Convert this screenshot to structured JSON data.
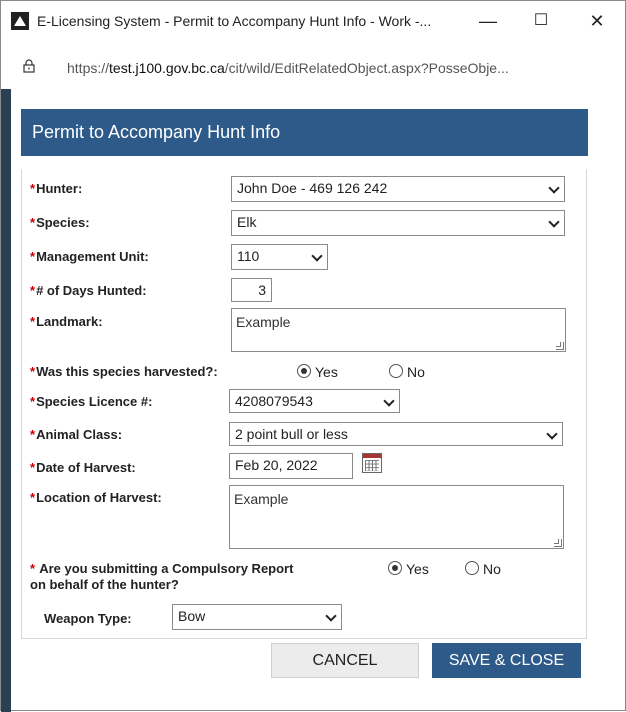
{
  "window": {
    "title": "E-Licensing System - Permit to Accompany Hunt Info - Work -...",
    "minimize_label": "—",
    "maximize_label": "☐",
    "close_label": "✕"
  },
  "address": {
    "url_prefix": "https://",
    "url_host": "test.j100.gov.bc.ca",
    "url_path": "/cit/wild/EditRelatedObject.aspx?PosseObje..."
  },
  "panel": {
    "title": "Permit to Accompany Hunt Info"
  },
  "form": {
    "required_mark": "*",
    "hunter": {
      "label": "Hunter:",
      "value": "John Doe - 469 126 242"
    },
    "species": {
      "label": "Species:",
      "value": "Elk"
    },
    "management_unit": {
      "label": "Management Unit:",
      "value": "110"
    },
    "days_hunted": {
      "label": "# of Days Hunted:",
      "value": "3"
    },
    "landmark": {
      "label": "Landmark:",
      "value": "Example"
    },
    "harvested": {
      "label": "Was this species harvested?:",
      "yes": "Yes",
      "no": "No",
      "selected": "Yes"
    },
    "species_licence": {
      "label": "Species Licence #:",
      "value": "4208079543"
    },
    "animal_class": {
      "label": "Animal Class:",
      "value": "2 point bull or less"
    },
    "date_of_harvest": {
      "label": "Date of Harvest:",
      "value": "Feb 20, 2022"
    },
    "location_of_harvest": {
      "label": "Location of Harvest:",
      "value": "Example"
    },
    "compulsory_report": {
      "label_line1": "Are you submitting a Compulsory Report",
      "label_line2": "on behalf of the hunter?",
      "yes": "Yes",
      "no": "No",
      "selected": "Yes"
    },
    "weapon_type": {
      "label": "Weapon Type:",
      "value": "Bow"
    }
  },
  "buttons": {
    "cancel": "CANCEL",
    "save_close": "SAVE & CLOSE"
  }
}
